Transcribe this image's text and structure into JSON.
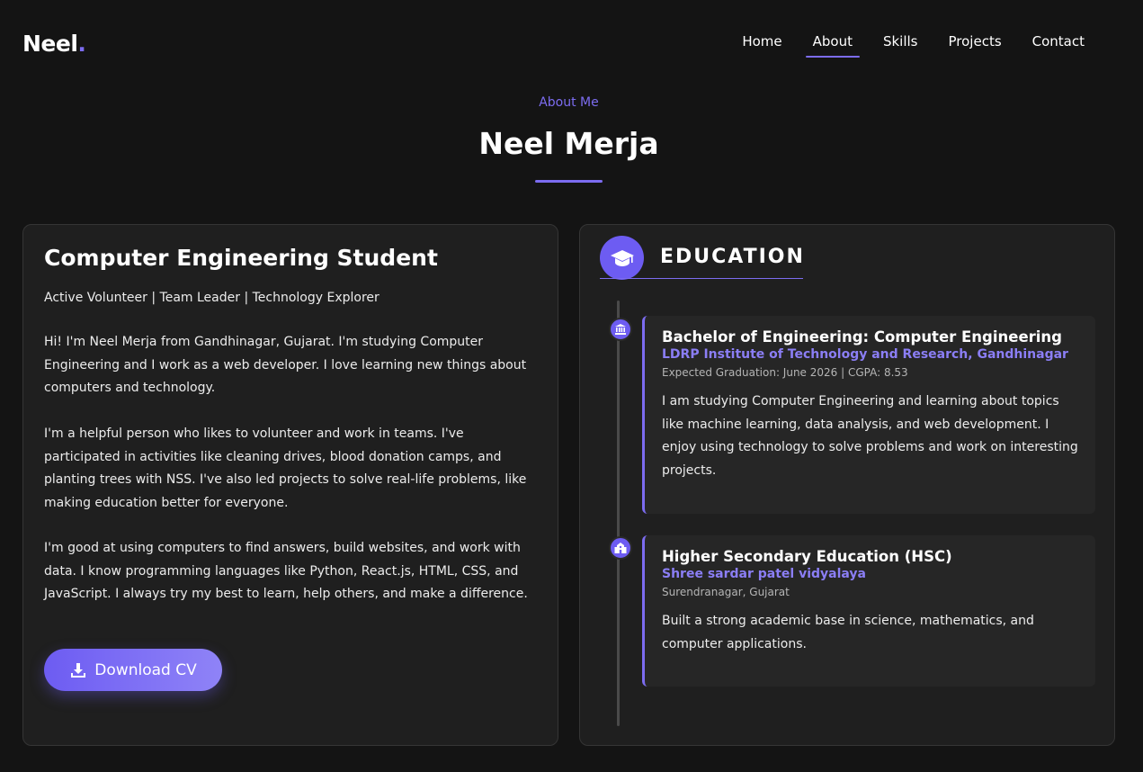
{
  "nav": {
    "logo_text": "Neel",
    "logo_dot": ".",
    "links": [
      "Home",
      "About",
      "Skills",
      "Projects",
      "Contact"
    ],
    "active": "About"
  },
  "header": {
    "eyebrow": "About Me",
    "title": "Neel Merja"
  },
  "about": {
    "role": "Computer Engineering Student",
    "tagline": "Active Volunteer | Team Leader | Technology Explorer",
    "paragraphs": [
      "Hi! I'm Neel Merja from Gandhinagar, Gujarat. I'm studying Computer Engineering and I work as a web developer. I love learning new things about computers and technology.",
      "I'm a helpful person who likes to volunteer and work in teams. I've participated in activities like cleaning drives, blood donation camps, and planting trees with NSS. I've also led projects to solve real-life problems, like making education better for everyone.",
      "I'm good at using computers to find answers, build websites, and work with data. I know programming languages like Python, React.js, HTML, CSS, and JavaScript. I always try my best to learn, help others, and make a difference."
    ],
    "cv_button": {
      "label": "Download CV",
      "icon": "download-icon"
    }
  },
  "education": {
    "heading": "EDUCATION",
    "icon": "graduation-cap-icon",
    "items": [
      {
        "icon": "university-icon",
        "degree": "Bachelor of Engineering: Computer Engineering",
        "institution": "LDRP Institute of Technology and Research, Gandhinagar",
        "meta": "Expected Graduation: June 2026 | CGPA: 8.53",
        "description": "I am studying Computer Engineering and learning about topics like machine learning, data analysis, and web development. I enjoy using technology to solve problems and work on interesting projects."
      },
      {
        "icon": "school-icon",
        "degree": "Higher Secondary Education (HSC)",
        "institution": "Shree sardar patel vidyalaya",
        "meta": "Surendranagar, Gujarat",
        "description": "Built a strong academic base in science, mathematics, and computer applications."
      }
    ]
  },
  "colors": {
    "accent": "#7c6cf0",
    "background": "#141414",
    "card": "#1f1f1f"
  }
}
